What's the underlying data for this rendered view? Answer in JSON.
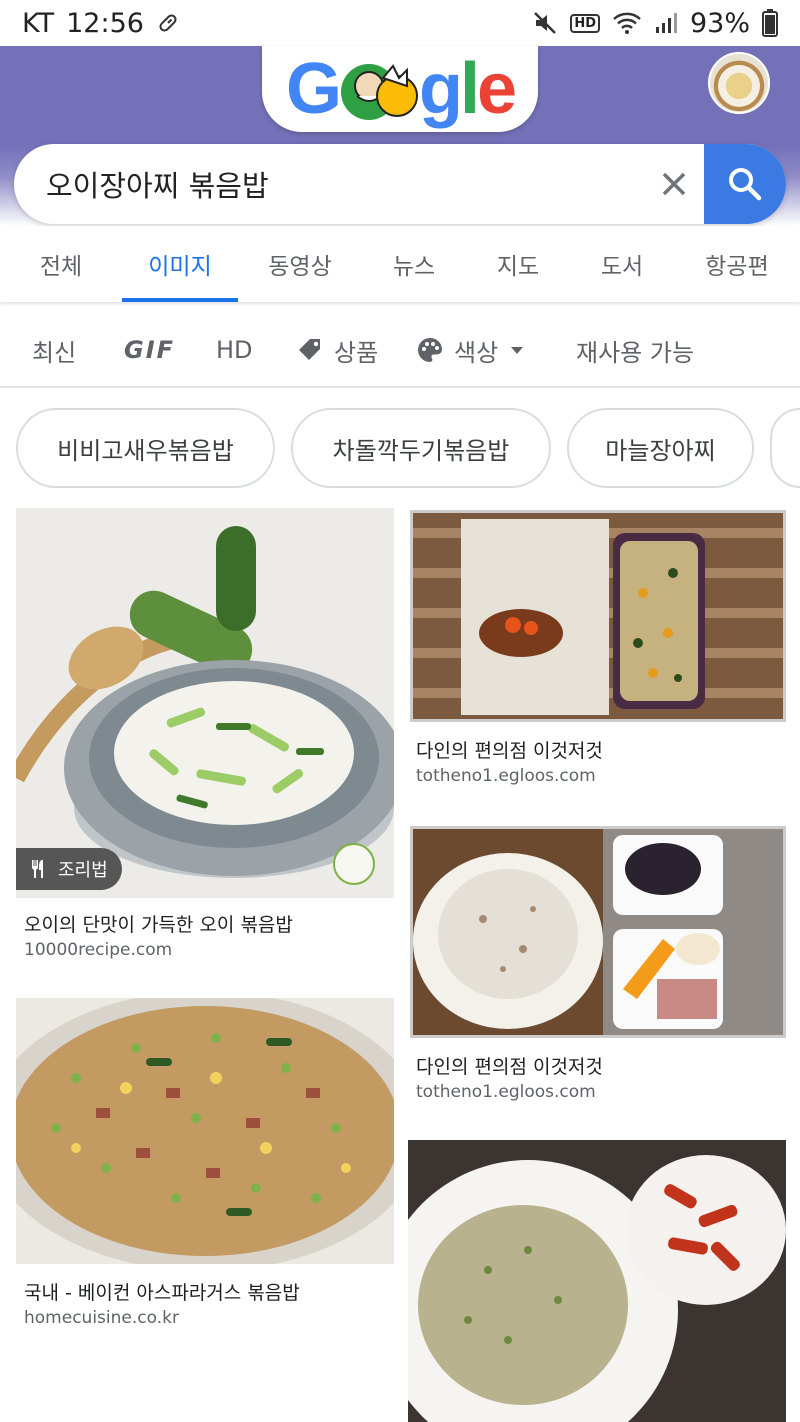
{
  "status_bar": {
    "carrier": "KT",
    "time": "12:56",
    "network_indicator": "HD",
    "battery": "93%"
  },
  "header": {
    "doodle_text": "Google"
  },
  "search": {
    "query": "오이장아찌 볶음밥"
  },
  "tabs": [
    {
      "label": "전체",
      "active": false
    },
    {
      "label": "이미지",
      "active": true
    },
    {
      "label": "동영상",
      "active": false
    },
    {
      "label": "뉴스",
      "active": false
    },
    {
      "label": "지도",
      "active": false
    },
    {
      "label": "도서",
      "active": false
    },
    {
      "label": "항공편",
      "active": false
    }
  ],
  "filters": {
    "recent": "최신",
    "gif": "GIF",
    "hd": "HD",
    "product": "상품",
    "color": "색상",
    "reuse": "재사용 가능"
  },
  "chips": [
    "비비고새우볶음밥",
    "차돌깍두기볶음밥",
    "마늘장아찌"
  ],
  "results": [
    {
      "title": "오이의 단맛이 가득한 오이 볶음밥",
      "source": "10000recipe.com",
      "badge": "조리법"
    },
    {
      "title": "다인의 편의점 이것저것",
      "source": "totheno1.egloos.com"
    },
    {
      "title": "다인의 편의점 이것저것",
      "source": "totheno1.egloos.com"
    },
    {
      "title": "국내 - 베이컨 아스파라거스 볶음밥",
      "source": "homecuisine.co.kr"
    }
  ],
  "colors": {
    "header_purple": "#7571b9",
    "accent_blue": "#1a73e8",
    "search_button": "#3c7ae3"
  }
}
